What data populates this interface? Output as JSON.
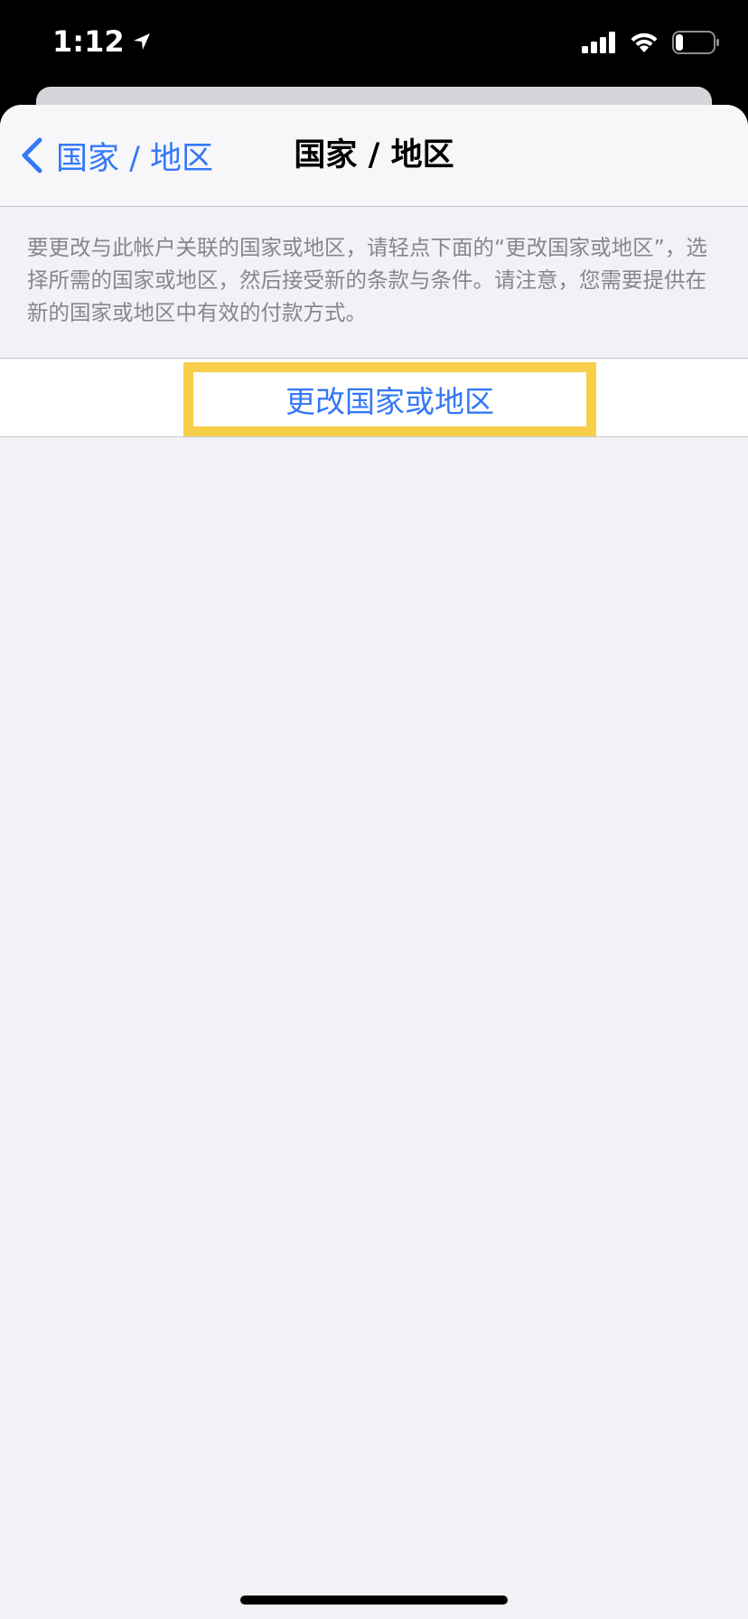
{
  "status_bar": {
    "time": "1:12",
    "location_icon": "location-arrow-icon",
    "signal_icon": "cellular-signal-icon",
    "wifi_icon": "wifi-icon",
    "battery_icon": "battery-icon",
    "battery_level": 0.2
  },
  "nav": {
    "back_label": "国家 / 地区",
    "back_icon": "chevron-left-icon",
    "title": "国家 / 地区"
  },
  "description": "要更改与此帐户关联的国家或地区，请轻点下面的“更改国家或地区”，选择所需的国家或地区，然后接受新的条款与条件。请注意，您需要提供在新的国家或地区中有效的付款方式。",
  "actions": {
    "change_region_label": "更改国家或地区"
  },
  "colors": {
    "accent": "#3478f6",
    "highlight": "#f7cf4a",
    "background": "#f1f1f6",
    "secondary_text": "#86868b"
  }
}
